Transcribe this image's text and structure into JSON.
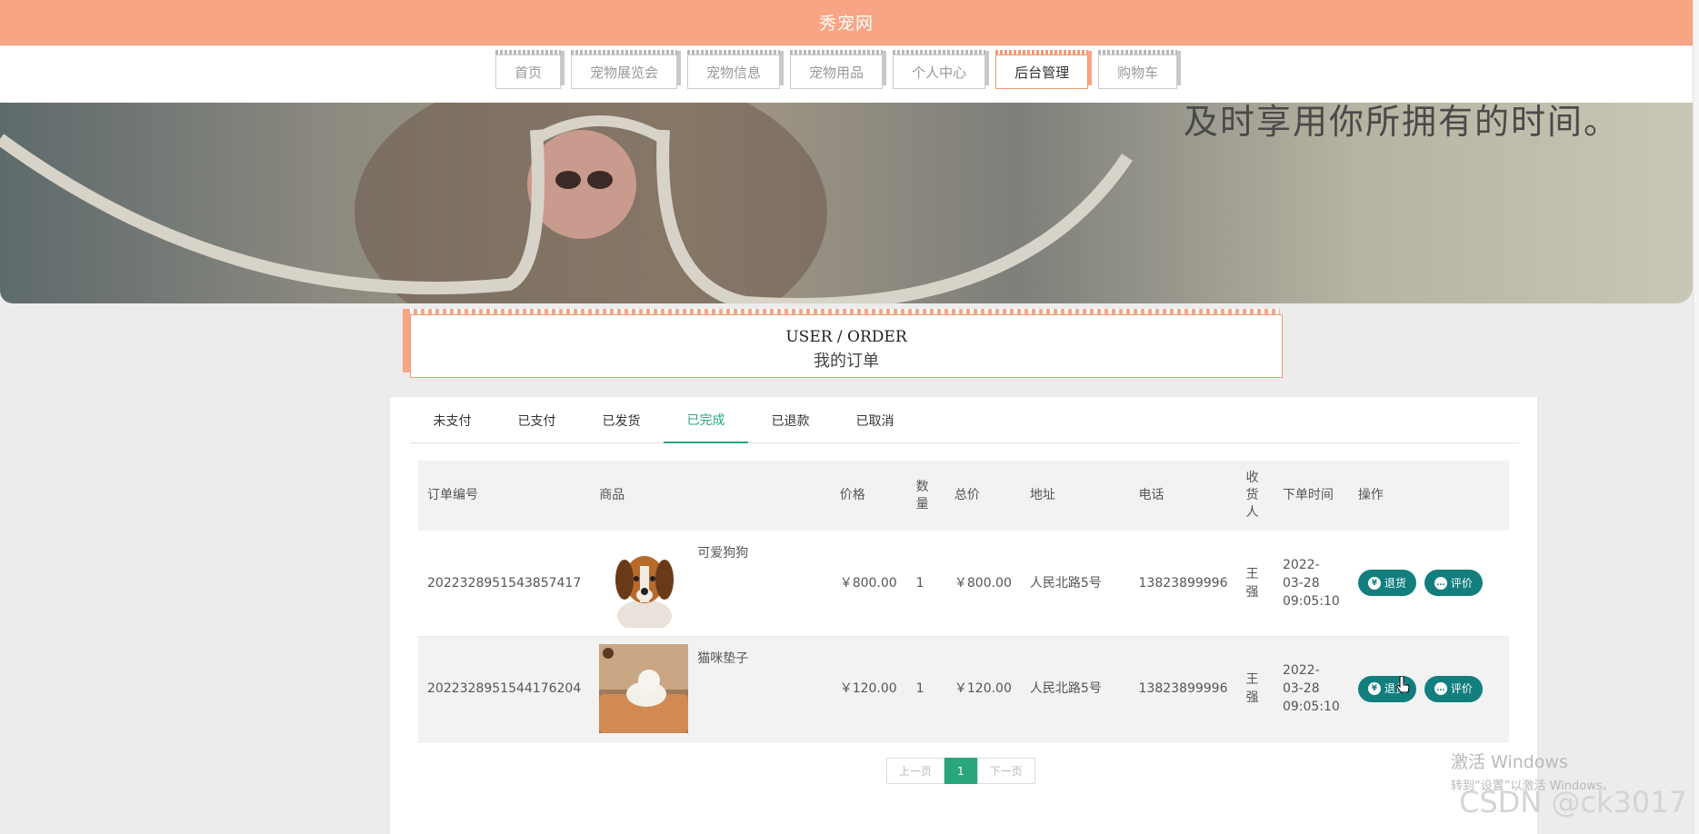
{
  "site": {
    "title": "秀宠网"
  },
  "nav": {
    "items": [
      {
        "label": "首页",
        "active": false
      },
      {
        "label": "宠物展览会",
        "active": false
      },
      {
        "label": "宠物信息",
        "active": false
      },
      {
        "label": "宠物用品",
        "active": false
      },
      {
        "label": "个人中心",
        "active": false
      },
      {
        "label": "后台管理",
        "active": true
      },
      {
        "label": "购物车",
        "active": false
      }
    ]
  },
  "banner": {
    "slogan": "及时享用你所拥有的时间。"
  },
  "section": {
    "title_en": "USER / ORDER",
    "title_zh": "我的订单"
  },
  "order_tabs": [
    {
      "label": "未支付",
      "active": false
    },
    {
      "label": "已支付",
      "active": false
    },
    {
      "label": "已发货",
      "active": false
    },
    {
      "label": "已完成",
      "active": true
    },
    {
      "label": "已退款",
      "active": false
    },
    {
      "label": "已取消",
      "active": false
    }
  ],
  "table": {
    "headers": {
      "order_no": "订单编号",
      "goods": "商品",
      "price": "价格",
      "qty": "数量",
      "total": "总价",
      "address": "地址",
      "phone": "电话",
      "receiver": "收货人",
      "time": "下单时间",
      "ops": "操作"
    },
    "rows": [
      {
        "order_no": "2022328951543857417",
        "goods": "可爱狗狗",
        "image": "dog-photo",
        "price": "￥800.00",
        "qty": "1",
        "total": "￥800.00",
        "address": "人民北路5号",
        "phone": "13823899996",
        "receiver": "王强",
        "time_date": "2022-03-28",
        "time_clock": "09:05:10"
      },
      {
        "order_no": "2022328951544176204",
        "goods": "猫咪垫子",
        "image": "cat-on-cushion-photo",
        "price": "￥120.00",
        "qty": "1",
        "total": "￥120.00",
        "address": "人民北路5号",
        "phone": "13823899996",
        "receiver": "王强",
        "time_date": "2022-03-28",
        "time_clock": "09:05:10"
      }
    ],
    "actions": {
      "refund": "退货",
      "review": "评价",
      "refund_icon": "yen-circle-icon",
      "review_icon": "chat-bubble-icon"
    }
  },
  "pager": {
    "prev": "上一页",
    "current": "1",
    "next": "下一页"
  },
  "overlay": {
    "watermark_line1": "激活 Windows",
    "watermark_line2": "转到“设置”以激活 Windows。",
    "csdn": "CSDN @ck3017"
  },
  "colors": {
    "header": "#f8a583",
    "accent_green": "#2aa67b",
    "button_teal": "#127e7e"
  }
}
